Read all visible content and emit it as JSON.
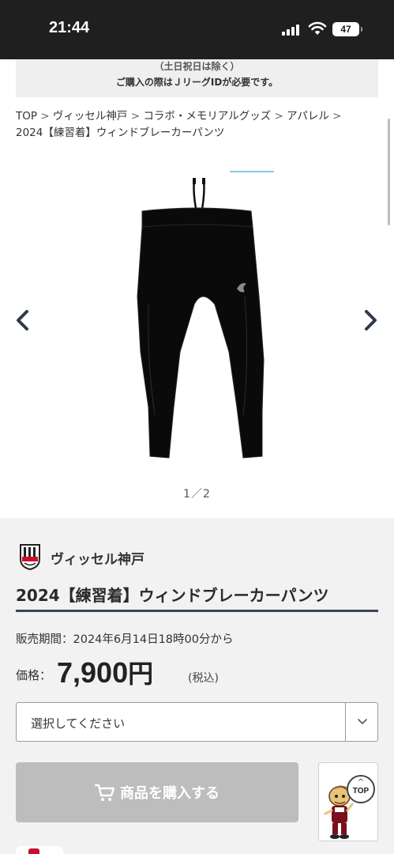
{
  "status_bar": {
    "time": "21:44",
    "battery": "47",
    "icons": [
      "signal-icon",
      "wifi-icon",
      "battery-icon"
    ]
  },
  "notice": {
    "line1": "（土日祝日は除く）",
    "line2": "ご購入の際はＪリーグIDが必要です。"
  },
  "breadcrumb": {
    "items": [
      "TOP",
      "ヴィッセル神戸",
      "コラボ・メモリアルグッズ",
      "アパレル",
      "2024【練習着】ウィンドブレーカーパンツ"
    ],
    "separator": ">"
  },
  "gallery": {
    "pager": "1／2",
    "icons": [
      "chevron-left-icon",
      "chevron-right-icon"
    ]
  },
  "product": {
    "club_name": "ヴィッセル神戸",
    "title": "2024【練習着】ウィンドブレーカーパンツ",
    "sale_period": "販売期間：2024年6月14日18時00分から",
    "price_label": "価格：",
    "price_number": "7,900",
    "price_yen": "円",
    "price_tax": "(税込)"
  },
  "select": {
    "placeholder": "選択してください",
    "icon": "chevron-down-icon"
  },
  "buy_button": {
    "label": "商品を購入する",
    "icon": "cart-icon"
  },
  "top_button": {
    "label": "TOP",
    "chevron": "^"
  },
  "colors": {
    "status_bar": "#1f1f1f",
    "panel_bg": "#f2f2f2",
    "title_rule": "#3d4656",
    "button_disabled": "#bdbdbd",
    "gallery_tab": "#8bc6ea",
    "club_red": "#c8102e"
  }
}
